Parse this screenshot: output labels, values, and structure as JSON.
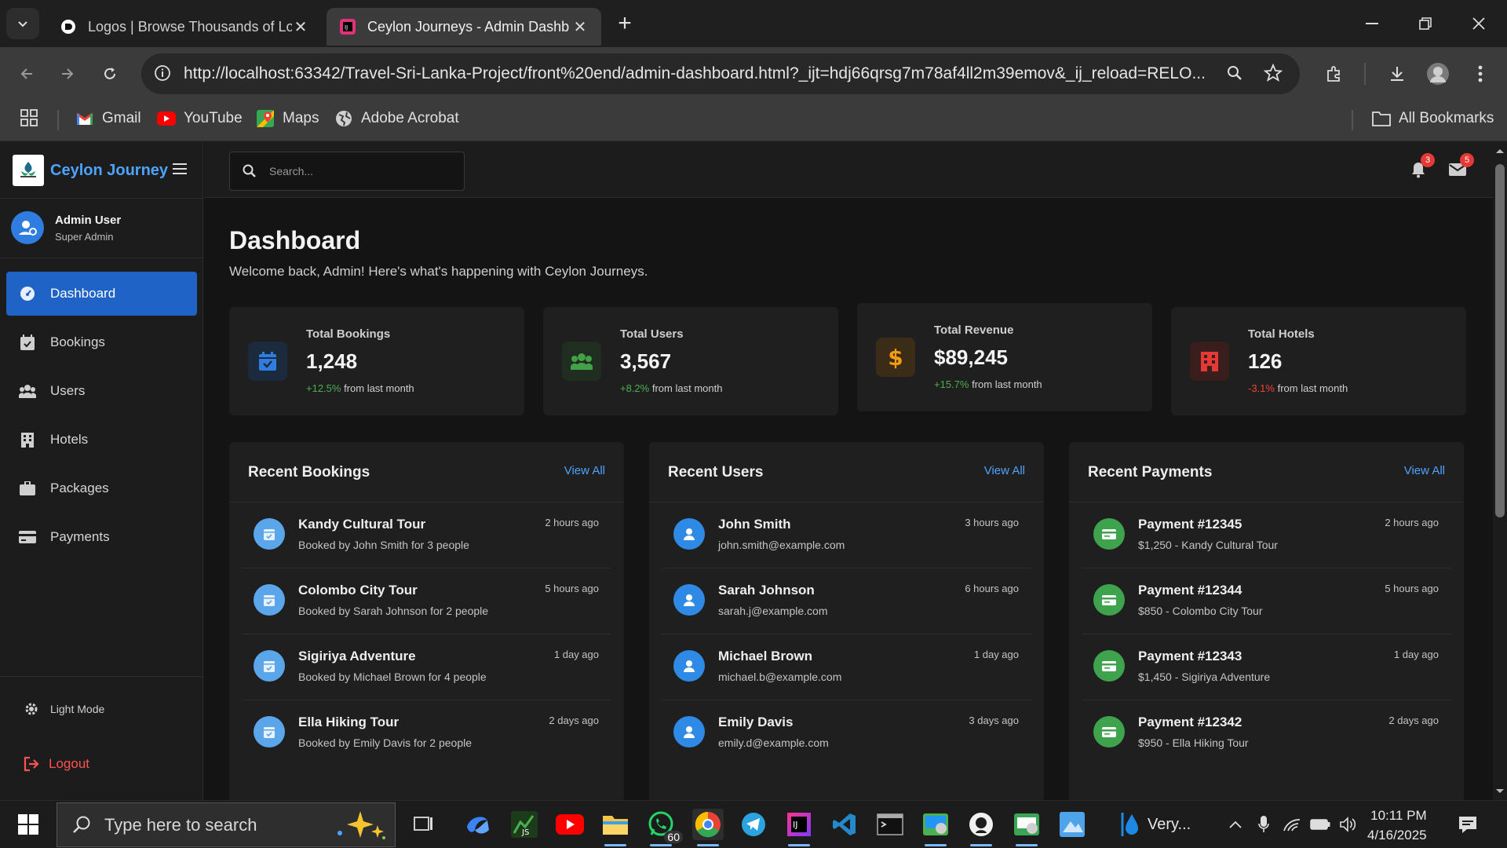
{
  "browser": {
    "tabs": [
      {
        "title": "Logos | Browse Thousands of Lo",
        "active": false
      },
      {
        "title": "Ceylon Journeys - Admin Dashb",
        "active": true
      }
    ],
    "url": "http://localhost:63342/Travel-Sri-Lanka-Project/front%20end/admin-dashboard.html?_ijt=hdj66qrsg7m78af4ll2m39emov&_ij_reload=RELO...",
    "bookmarks": [
      {
        "label": "Gmail",
        "icon": "gmail-icon"
      },
      {
        "label": "YouTube",
        "icon": "youtube-icon"
      },
      {
        "label": "Maps",
        "icon": "maps-icon"
      },
      {
        "label": "Adobe Acrobat",
        "icon": "globe-icon"
      }
    ],
    "all_bookmarks": "All Bookmarks"
  },
  "sidebar": {
    "brand": "Ceylon Journey",
    "user": {
      "name": "Admin User",
      "role": "Super Admin"
    },
    "items": [
      {
        "label": "Dashboard",
        "icon": "dashboard-icon",
        "active": true
      },
      {
        "label": "Bookings",
        "icon": "calendar-icon",
        "active": false
      },
      {
        "label": "Users",
        "icon": "users-icon",
        "active": false
      },
      {
        "label": "Hotels",
        "icon": "building-icon",
        "active": false
      },
      {
        "label": "Packages",
        "icon": "suitcase-icon",
        "active": false
      },
      {
        "label": "Payments",
        "icon": "credit-card-icon",
        "active": false
      }
    ],
    "light_mode": "Light Mode",
    "logout": "Logout"
  },
  "topbar": {
    "search_placeholder": "Search...",
    "notifications_count": "3",
    "messages_count": "5"
  },
  "main": {
    "title": "Dashboard",
    "subtitle": "Welcome back, Admin! Here's what's happening with Ceylon Journeys.",
    "stats": [
      {
        "label": "Total Bookings",
        "value": "1,248",
        "change": "+12.5%",
        "change_text": "from last month",
        "trend": "up",
        "color": "#2f7de0"
      },
      {
        "label": "Total Users",
        "value": "3,567",
        "change": "+8.2%",
        "change_text": "from last month",
        "trend": "up",
        "color": "#43a047"
      },
      {
        "label": "Total Revenue",
        "value": "$89,245",
        "change": "+15.7%",
        "change_text": "from last month",
        "trend": "up",
        "color": "#f39c12"
      },
      {
        "label": "Total Hotels",
        "value": "126",
        "change": "-3.1%",
        "change_text": "from last month",
        "trend": "down",
        "color": "#e53935"
      }
    ],
    "panels": [
      {
        "title": "Recent Bookings",
        "view_all": "View All",
        "rows": [
          {
            "title": "Kandy Cultural Tour",
            "subtitle": "Booked by John Smith for 3 people",
            "time": "2 hours ago"
          },
          {
            "title": "Colombo City Tour",
            "subtitle": "Booked by Sarah Johnson for 2 people",
            "time": "5 hours ago"
          },
          {
            "title": "Sigiriya Adventure",
            "subtitle": "Booked by Michael Brown for 4 people",
            "time": "1 day ago"
          },
          {
            "title": "Ella Hiking Tour",
            "subtitle": "Booked by Emily Davis for 2 people",
            "time": "2 days ago"
          }
        ]
      },
      {
        "title": "Recent Users",
        "view_all": "View All",
        "rows": [
          {
            "title": "John Smith",
            "subtitle": "john.smith@example.com",
            "time": "3 hours ago"
          },
          {
            "title": "Sarah Johnson",
            "subtitle": "sarah.j@example.com",
            "time": "6 hours ago"
          },
          {
            "title": "Michael Brown",
            "subtitle": "michael.b@example.com",
            "time": "1 day ago"
          },
          {
            "title": "Emily Davis",
            "subtitle": "emily.d@example.com",
            "time": "3 days ago"
          }
        ]
      },
      {
        "title": "Recent Payments",
        "view_all": "View All",
        "rows": [
          {
            "title": "Payment #12345",
            "subtitle": "$1,250 - Kandy Cultural Tour",
            "time": "2 hours ago"
          },
          {
            "title": "Payment #12344",
            "subtitle": "$850 - Colombo City Tour",
            "time": "5 hours ago"
          },
          {
            "title": "Payment #12343",
            "subtitle": "$1,450 - Sigiriya Adventure",
            "time": "1 day ago"
          },
          {
            "title": "Payment #12342",
            "subtitle": "$950 - Ella Hiking Tour",
            "time": "2 days ago"
          }
        ]
      }
    ]
  },
  "taskbar": {
    "search_placeholder": "Type here to search",
    "weather": "Very...",
    "whatsapp_badge": "60",
    "time": "10:11 PM",
    "date": "4/16/2025"
  }
}
